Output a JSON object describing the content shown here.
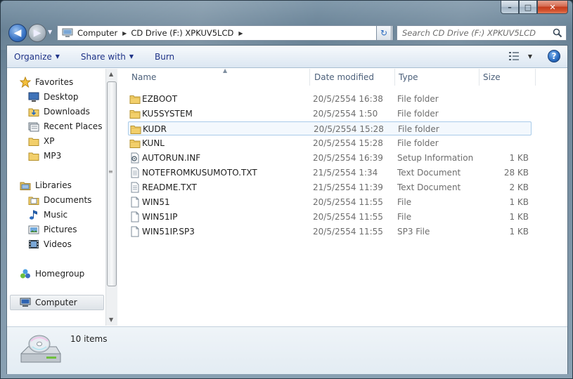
{
  "window": {
    "caption_min": "–",
    "caption_max": "□",
    "caption_close": "✕"
  },
  "address_bar": {
    "crumbs": [
      "Computer",
      "CD Drive (F:) XPKUV5LCD"
    ],
    "search_placeholder": "Search CD Drive (F:) XPKUV5LCD"
  },
  "toolbar": {
    "organize": "Organize",
    "share_with": "Share with",
    "burn": "Burn"
  },
  "nav_pane": {
    "favorites": {
      "label": "Favorites",
      "items": [
        {
          "label": "Desktop",
          "icon": "desktop-icon"
        },
        {
          "label": "Downloads",
          "icon": "downloads-icon"
        },
        {
          "label": "Recent Places",
          "icon": "recent-places-icon"
        },
        {
          "label": "XP",
          "icon": "folder-icon"
        },
        {
          "label": "MP3",
          "icon": "folder-icon"
        }
      ]
    },
    "libraries": {
      "label": "Libraries",
      "items": [
        {
          "label": "Documents",
          "icon": "documents-icon"
        },
        {
          "label": "Music",
          "icon": "music-icon"
        },
        {
          "label": "Pictures",
          "icon": "pictures-icon"
        },
        {
          "label": "Videos",
          "icon": "videos-icon"
        }
      ]
    },
    "homegroup": "Homegroup",
    "computer": "Computer"
  },
  "columns": {
    "name": "Name",
    "date": "Date modified",
    "type": "Type",
    "size": "Size"
  },
  "files": [
    {
      "name": "EZBOOT",
      "date": "20/5/2554 16:38",
      "type": "File folder",
      "size": "",
      "icon": "folder-icon"
    },
    {
      "name": "KU5SYSTEM",
      "date": "20/5/2554 1:50",
      "type": "File folder",
      "size": "",
      "icon": "folder-icon"
    },
    {
      "name": "KUDR",
      "date": "20/5/2554 15:28",
      "type": "File folder",
      "size": "",
      "icon": "folder-icon",
      "selected": true
    },
    {
      "name": "KUNL",
      "date": "20/5/2554 15:28",
      "type": "File folder",
      "size": "",
      "icon": "folder-icon"
    },
    {
      "name": "AUTORUN.INF",
      "date": "20/5/2554 16:39",
      "type": "Setup Information",
      "size": "1 KB",
      "icon": "setup-info-icon"
    },
    {
      "name": "NOTEFROMKUSUMOTO.TXT",
      "date": "21/5/2554 1:34",
      "type": "Text Document",
      "size": "28 KB",
      "icon": "text-document-icon"
    },
    {
      "name": "README.TXT",
      "date": "21/5/2554 11:39",
      "type": "Text Document",
      "size": "2 KB",
      "icon": "text-document-icon"
    },
    {
      "name": "WIN51",
      "date": "20/5/2554 11:55",
      "type": "File",
      "size": "1 KB",
      "icon": "file-icon"
    },
    {
      "name": "WIN51IP",
      "date": "20/5/2554 11:55",
      "type": "File",
      "size": "1 KB",
      "icon": "file-icon"
    },
    {
      "name": "WIN51IP.SP3",
      "date": "20/5/2554 11:55",
      "type": "SP3 File",
      "size": "1 KB",
      "icon": "file-icon"
    }
  ],
  "details": {
    "item_count": "10 items"
  }
}
